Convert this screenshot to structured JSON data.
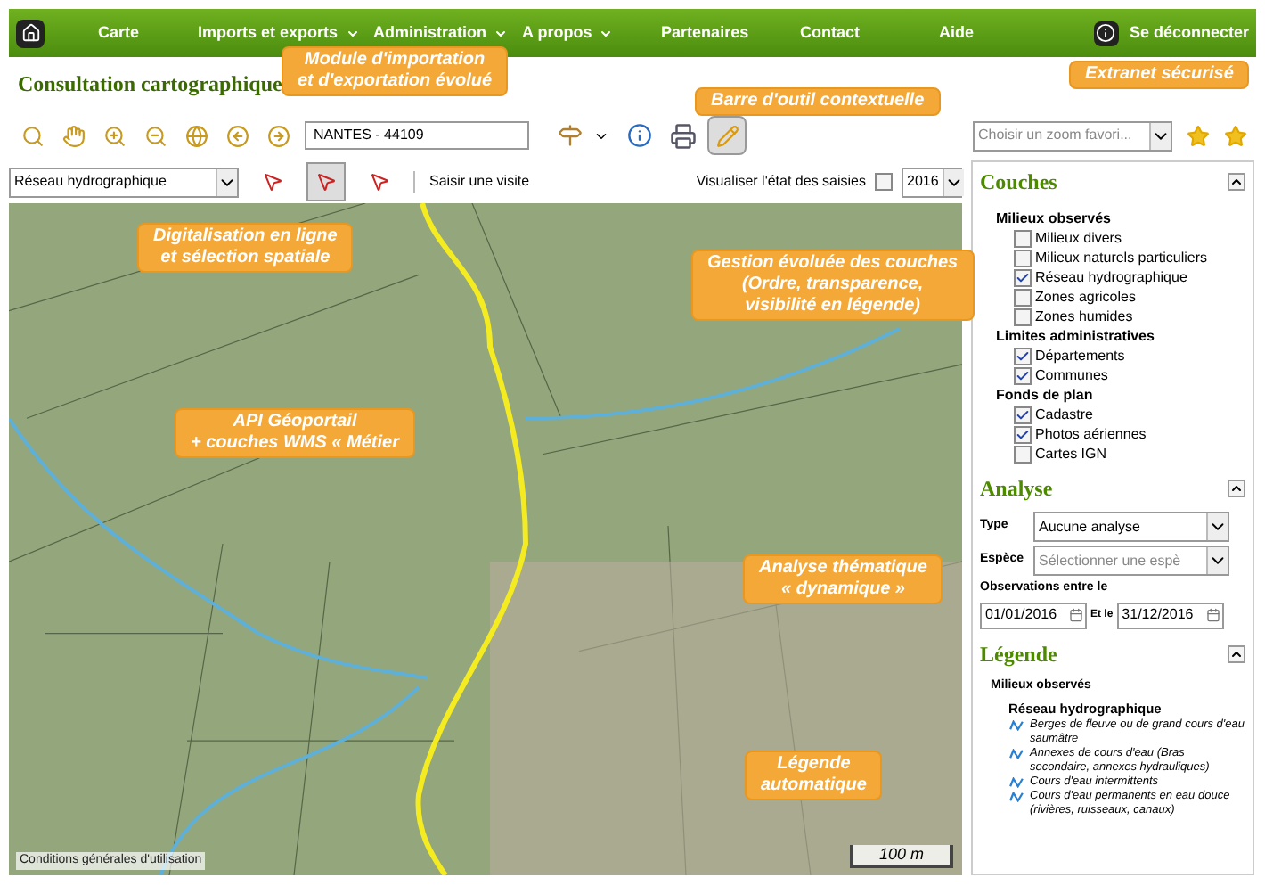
{
  "nav": {
    "items": [
      {
        "label": "Carte",
        "has_menu": false
      },
      {
        "label": "Imports et exports",
        "has_menu": true
      },
      {
        "label": "Administration",
        "has_menu": true
      },
      {
        "label": "A propos",
        "has_menu": true
      },
      {
        "label": "Partenaires",
        "has_menu": false
      },
      {
        "label": "Contact",
        "has_menu": false
      },
      {
        "label": "Aide",
        "has_menu": false
      }
    ],
    "logout": "Se déconnecter"
  },
  "page_title": "Consultation cartographique",
  "toolbar": {
    "search_value": "NANTES - 44109",
    "edit_mode": true,
    "zoom_placeholder": "Choisir un zoom favori..."
  },
  "layer_bar": {
    "layer": "Réseau hydrographique",
    "selection_tools": [
      {
        "selected": false
      },
      {
        "selected": true
      },
      {
        "selected": false
      }
    ],
    "visit_link": "Saisir une visite",
    "show_state_label": "Visualiser l'état des saisies",
    "show_state": false,
    "year": "2016"
  },
  "map": {
    "terms": "Conditions générales d'utilisation",
    "scale": "100 m"
  },
  "couches": {
    "title": "Couches",
    "groups": [
      {
        "title": "Milieux observés",
        "items": [
          {
            "label": "Milieux divers",
            "checked": false
          },
          {
            "label": "Milieux naturels particuliers",
            "checked": false
          },
          {
            "label": "Réseau hydrographique",
            "checked": true
          },
          {
            "label": "Zones agricoles",
            "checked": false
          },
          {
            "label": "Zones humides",
            "checked": false
          }
        ]
      },
      {
        "title": "Limites administratives",
        "items": [
          {
            "label": "Départements",
            "checked": true
          },
          {
            "label": "Communes",
            "checked": true
          }
        ]
      },
      {
        "title": "Fonds de plan",
        "items": [
          {
            "label": "Cadastre",
            "checked": true
          },
          {
            "label": "Photos aériennes",
            "checked": true
          },
          {
            "label": "Cartes IGN",
            "checked": false
          }
        ]
      }
    ]
  },
  "analyse": {
    "title": "Analyse",
    "type_label": "Type",
    "type_value": "Aucune analyse",
    "species_label": "Espèce",
    "species_placeholder": "Sélectionner une espè",
    "period_label": "Observations entre le",
    "start": "01/01/2016",
    "and_label": "Et le",
    "end": "31/12/2016"
  },
  "legende": {
    "title": "Légende",
    "group": "Milieux observés",
    "subgroup": "Réseau hydrographique",
    "items": [
      "Berges de fleuve ou de grand cours d'eau saumâtre",
      "Annexes de cours d'eau (Bras secondaire, annexes hydrauliques)",
      "Cours d'eau intermittents",
      "Cours d'eau permanents en eau douce (rivières, ruisseaux, canaux)"
    ]
  },
  "callouts": [
    "Module d'importation\net d'exportation évolué",
    "Extranet sécurisé",
    "Barre d'outil contextuelle",
    "Digitalisation en ligne\net sélection spatiale",
    "Gestion évoluée des couches\n(Ordre, transparence,\nvisibilité en légende)",
    "API Géoportail\n+ couches WMS « Métier",
    "Analyse thématique\n« dynamique »",
    "Légende\nautomatique"
  ]
}
